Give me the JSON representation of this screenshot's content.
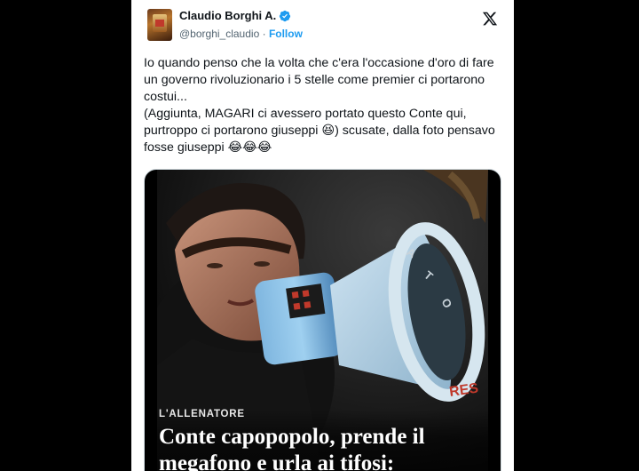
{
  "author": {
    "display_name": "Claudio Borghi A.",
    "handle": "@borghi_claudio",
    "separator": "·",
    "follow_label": "Follow",
    "verified_color": "#1d9bf0"
  },
  "platform_icon": "x-logo-icon",
  "tweet": {
    "lines": [
      "Io quando penso che la volta che c'era l'occasione d'oro di fare un governo rivoluzionario i 5 stelle come premier ci portarono costui...",
      "(Aggiunta, MAGARI ci avessero portato questo Conte qui, purtroppo ci portarono giuseppi 😆) scusate, dalla foto pensavo fosse giuseppi 😂😂😂"
    ]
  },
  "media": {
    "kicker": "L'ALLENATORE",
    "headline": "Conte capopopolo, prende il megafono e urla ai tifosi:",
    "megaphone_text": "RES"
  },
  "colors": {
    "accent": "#1d9bf0",
    "text": "#0f1419",
    "muted": "#536471"
  }
}
